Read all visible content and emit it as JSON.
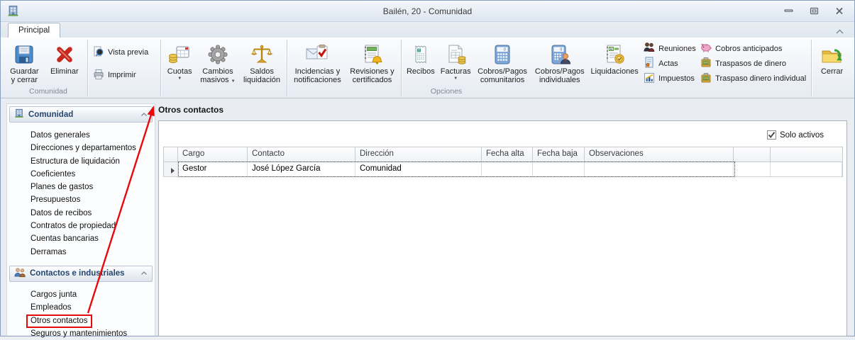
{
  "window": {
    "title": "Bailén, 20 - Comunidad"
  },
  "ribbon": {
    "tab_label": "Principal",
    "group_labels": {
      "comunidad": "Comunidad",
      "opciones": "Opciones"
    },
    "buttons": {
      "guardar_cerrar": "Guardar y cerrar",
      "eliminar": "Eliminar",
      "vista_previa": "Vista previa",
      "imprimir": "Imprimir",
      "cuotas": "Cuotas",
      "cambios_masivos": "Cambios masivos",
      "saldos_liquidacion": "Saldos liquidación",
      "incidencias": "Incidencias y notificaciones",
      "revisiones": "Revisiones y certificados",
      "recibos": "Recibos",
      "facturas": "Facturas",
      "cobros_pagos_comunitarios": "Cobros/Pagos comunitarios",
      "cobros_pagos_individuales": "Cobros/Pagos individuales",
      "liquidaciones": "Liquidaciones",
      "reuniones": "Reuniones",
      "actas": "Actas",
      "impuestos": "Impuestos",
      "cobros_anticipados": "Cobros anticipados",
      "traspasos_dinero": "Traspasos de dinero",
      "traspaso_dinero_individual": "Traspaso dinero individual",
      "cerrar": "Cerrar"
    }
  },
  "sidebar": {
    "groups": [
      {
        "title": "Comunidad",
        "items": [
          "Datos generales",
          "Direcciones y departamentos",
          "Estructura de liquidación",
          "Coeficientes",
          "Planes de gastos",
          "Presupuestos",
          "Datos de recibos",
          "Contratos de propiedad",
          "Cuentas bancarias",
          "Derramas"
        ]
      },
      {
        "title": "Contactos e industriales",
        "items": [
          "Cargos junta",
          "Empleados",
          "Otros contactos",
          "Seguros y mantenimientos"
        ]
      }
    ]
  },
  "main": {
    "title": "Otros contactos",
    "filter": {
      "label": "Solo activos",
      "checked": true
    },
    "table": {
      "columns": [
        "Cargo",
        "Contacto",
        "Dirección",
        "Fecha alta",
        "Fecha baja",
        "Observaciones"
      ],
      "rows": [
        {
          "cells": [
            "Gestor",
            "José López García",
            "Comunidad",
            "",
            "",
            ""
          ]
        }
      ]
    }
  },
  "annotation": {
    "color": "#e60a0a",
    "highlighted_item": "Otros contactos"
  }
}
